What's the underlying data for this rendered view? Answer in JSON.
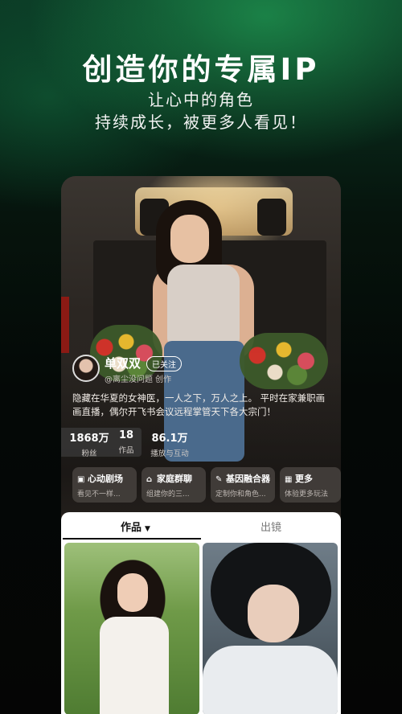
{
  "promo": {
    "headline": "创造你的专属IP",
    "line1": "让心中的角色",
    "line2": "持续成长，被更多人看见！"
  },
  "profile": {
    "name": "单双双",
    "follow_label": "已关注",
    "creator": "@离尘没问题 创作",
    "bio": "隐藏在华夏的女神医，一人之下，万人之上。 平时在家兼职画画直播，偶尔开飞书会议远程掌管天下各大宗门！"
  },
  "stats": [
    {
      "value": "1868万",
      "label": "粉丝"
    },
    {
      "value": "18",
      "label": "作品"
    },
    {
      "value": "86.1万",
      "label": "播放与互动"
    }
  ],
  "features": [
    {
      "icon": "heart-book-icon",
      "title": "心动剧场",
      "desc": "看见不一样..."
    },
    {
      "icon": "home-chat-icon",
      "title": "家庭群聊",
      "desc": "组建你的三..."
    },
    {
      "icon": "dna-fusion-icon",
      "title": "基因融合器",
      "desc": "定制你和角色..."
    },
    {
      "icon": "grid-more-icon",
      "title": "更多",
      "desc": "体验更多玩法"
    }
  ],
  "tabs": {
    "works": "作品",
    "cameo": "出镜"
  },
  "colors": {
    "accent_green": "#1fa35c",
    "background": "#050505"
  }
}
